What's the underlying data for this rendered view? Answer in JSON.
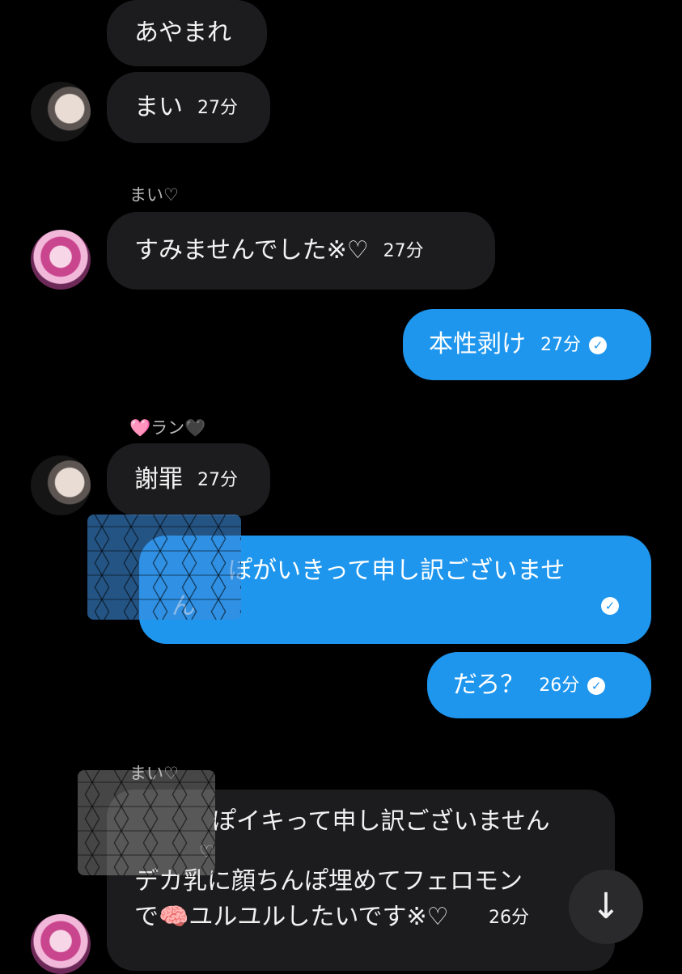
{
  "messages": {
    "m1": {
      "text": "あやまれ"
    },
    "m2": {
      "text": "まい",
      "time": "27分"
    },
    "m3": {
      "sender": "まい♡",
      "text": "すみませんでした※♡",
      "time": "27分"
    },
    "m4": {
      "text": "本性剥け",
      "time": "27分"
    },
    "m5": {
      "sender": "🩷ラン🖤",
      "text": "謝罪",
      "time": "27分"
    },
    "m6": {
      "line1": "ぽがいきって申し訳ございませ",
      "line2": "ん"
    },
    "m7": {
      "text": "だろ？",
      "time": "26分"
    },
    "m8": {
      "sender": "まい♡",
      "line1": "ぽイキって申し訳ございません",
      "quote_sender": "♡",
      "line2": "デカ乳に顔ちんぽ埋めてフェロモン",
      "line3": "で🧠ユルユルしたいです※♡",
      "time": "26分"
    }
  },
  "icons": {
    "check": "✓",
    "scroll_down": "↓"
  },
  "colors": {
    "background": "#000000",
    "incoming_bubble": "#1c1c1e",
    "outgoing_bubble": "#1e96ee"
  }
}
